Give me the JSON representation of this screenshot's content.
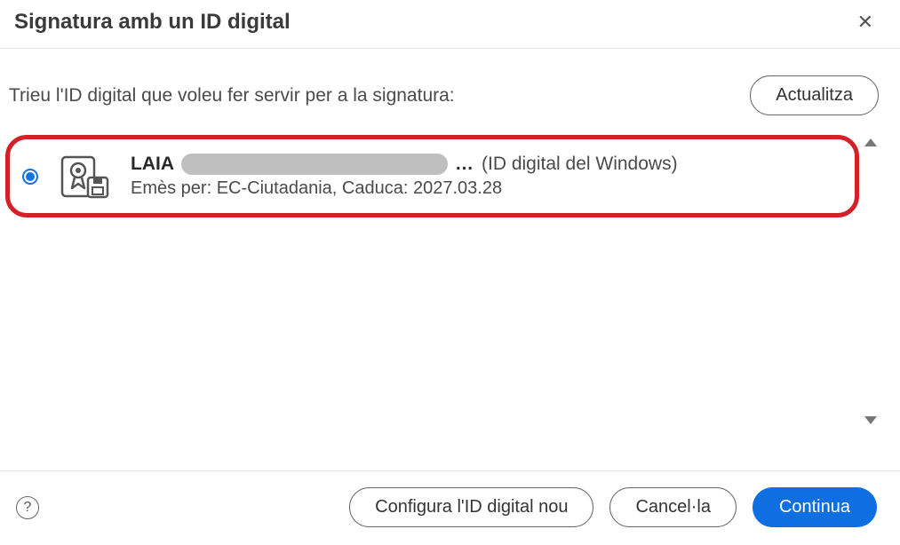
{
  "dialog": {
    "title": "Signatura amb un ID digital",
    "instruction": "Trieu l'ID digital que voleu fer servir per a la signatura:",
    "refreshLabel": "Actualitza"
  },
  "certificate": {
    "name": "LAIA",
    "ellipsis": "…",
    "sourceLabel": "(ID digital del Windows)",
    "issuer": "EC-Ciutadania",
    "expires": "2027.03.28",
    "issuedByWord": "Emès per:",
    "expiresWord": "Caduca:"
  },
  "footer": {
    "configureLabel": "Configura l'ID digital nou",
    "cancelLabel": "Cancel·la",
    "continueLabel": "Continua"
  }
}
